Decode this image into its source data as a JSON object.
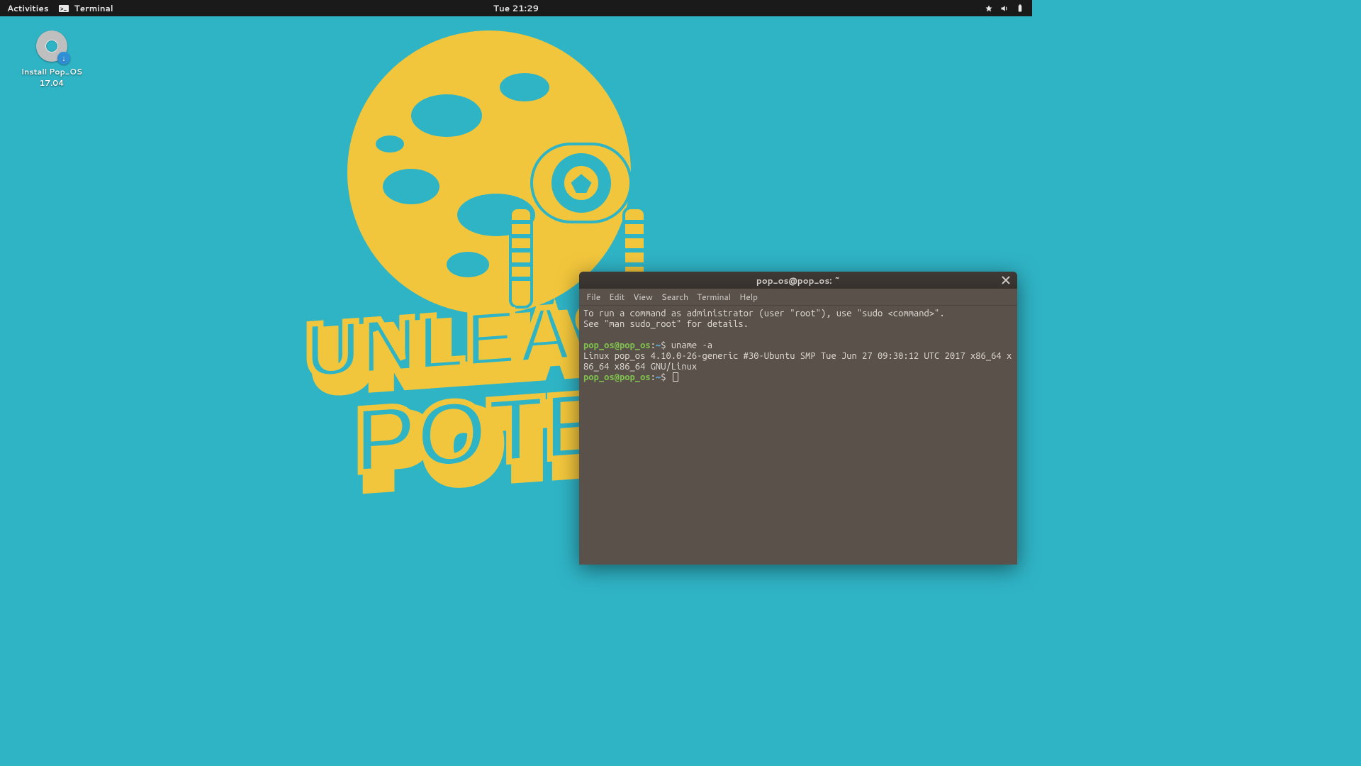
{
  "topbar": {
    "activities": "Activities",
    "app_label": "Terminal",
    "clock": "Tue 21:29"
  },
  "desktop_icon": {
    "label_line1": "Install Pop_OS",
    "label_line2": "17.04"
  },
  "wallpaper": {
    "text_line1": "UNLEASH",
    "text_line2": "POTEN"
  },
  "terminal": {
    "title": "pop_os@pop_os: ~",
    "menu": {
      "file": "File",
      "edit": "Edit",
      "view": "View",
      "search": "Search",
      "terminal": "Terminal",
      "help": "Help"
    },
    "motd_line1": "To run a command as administrator (user \"root\"), use \"sudo <command>\".",
    "motd_line2": "See \"man sudo_root\" for details.",
    "prompt_user": "pop_os@pop_os",
    "prompt_sep": ":",
    "prompt_path": "~",
    "prompt_sym": "$",
    "cmd1": "uname -a",
    "out1": "Linux pop_os 4.10.0-26-generic #30-Ubuntu SMP Tue Jun 27 09:30:12 UTC 2017 x86_64 x86_64 x86_64 GNU/Linux"
  }
}
